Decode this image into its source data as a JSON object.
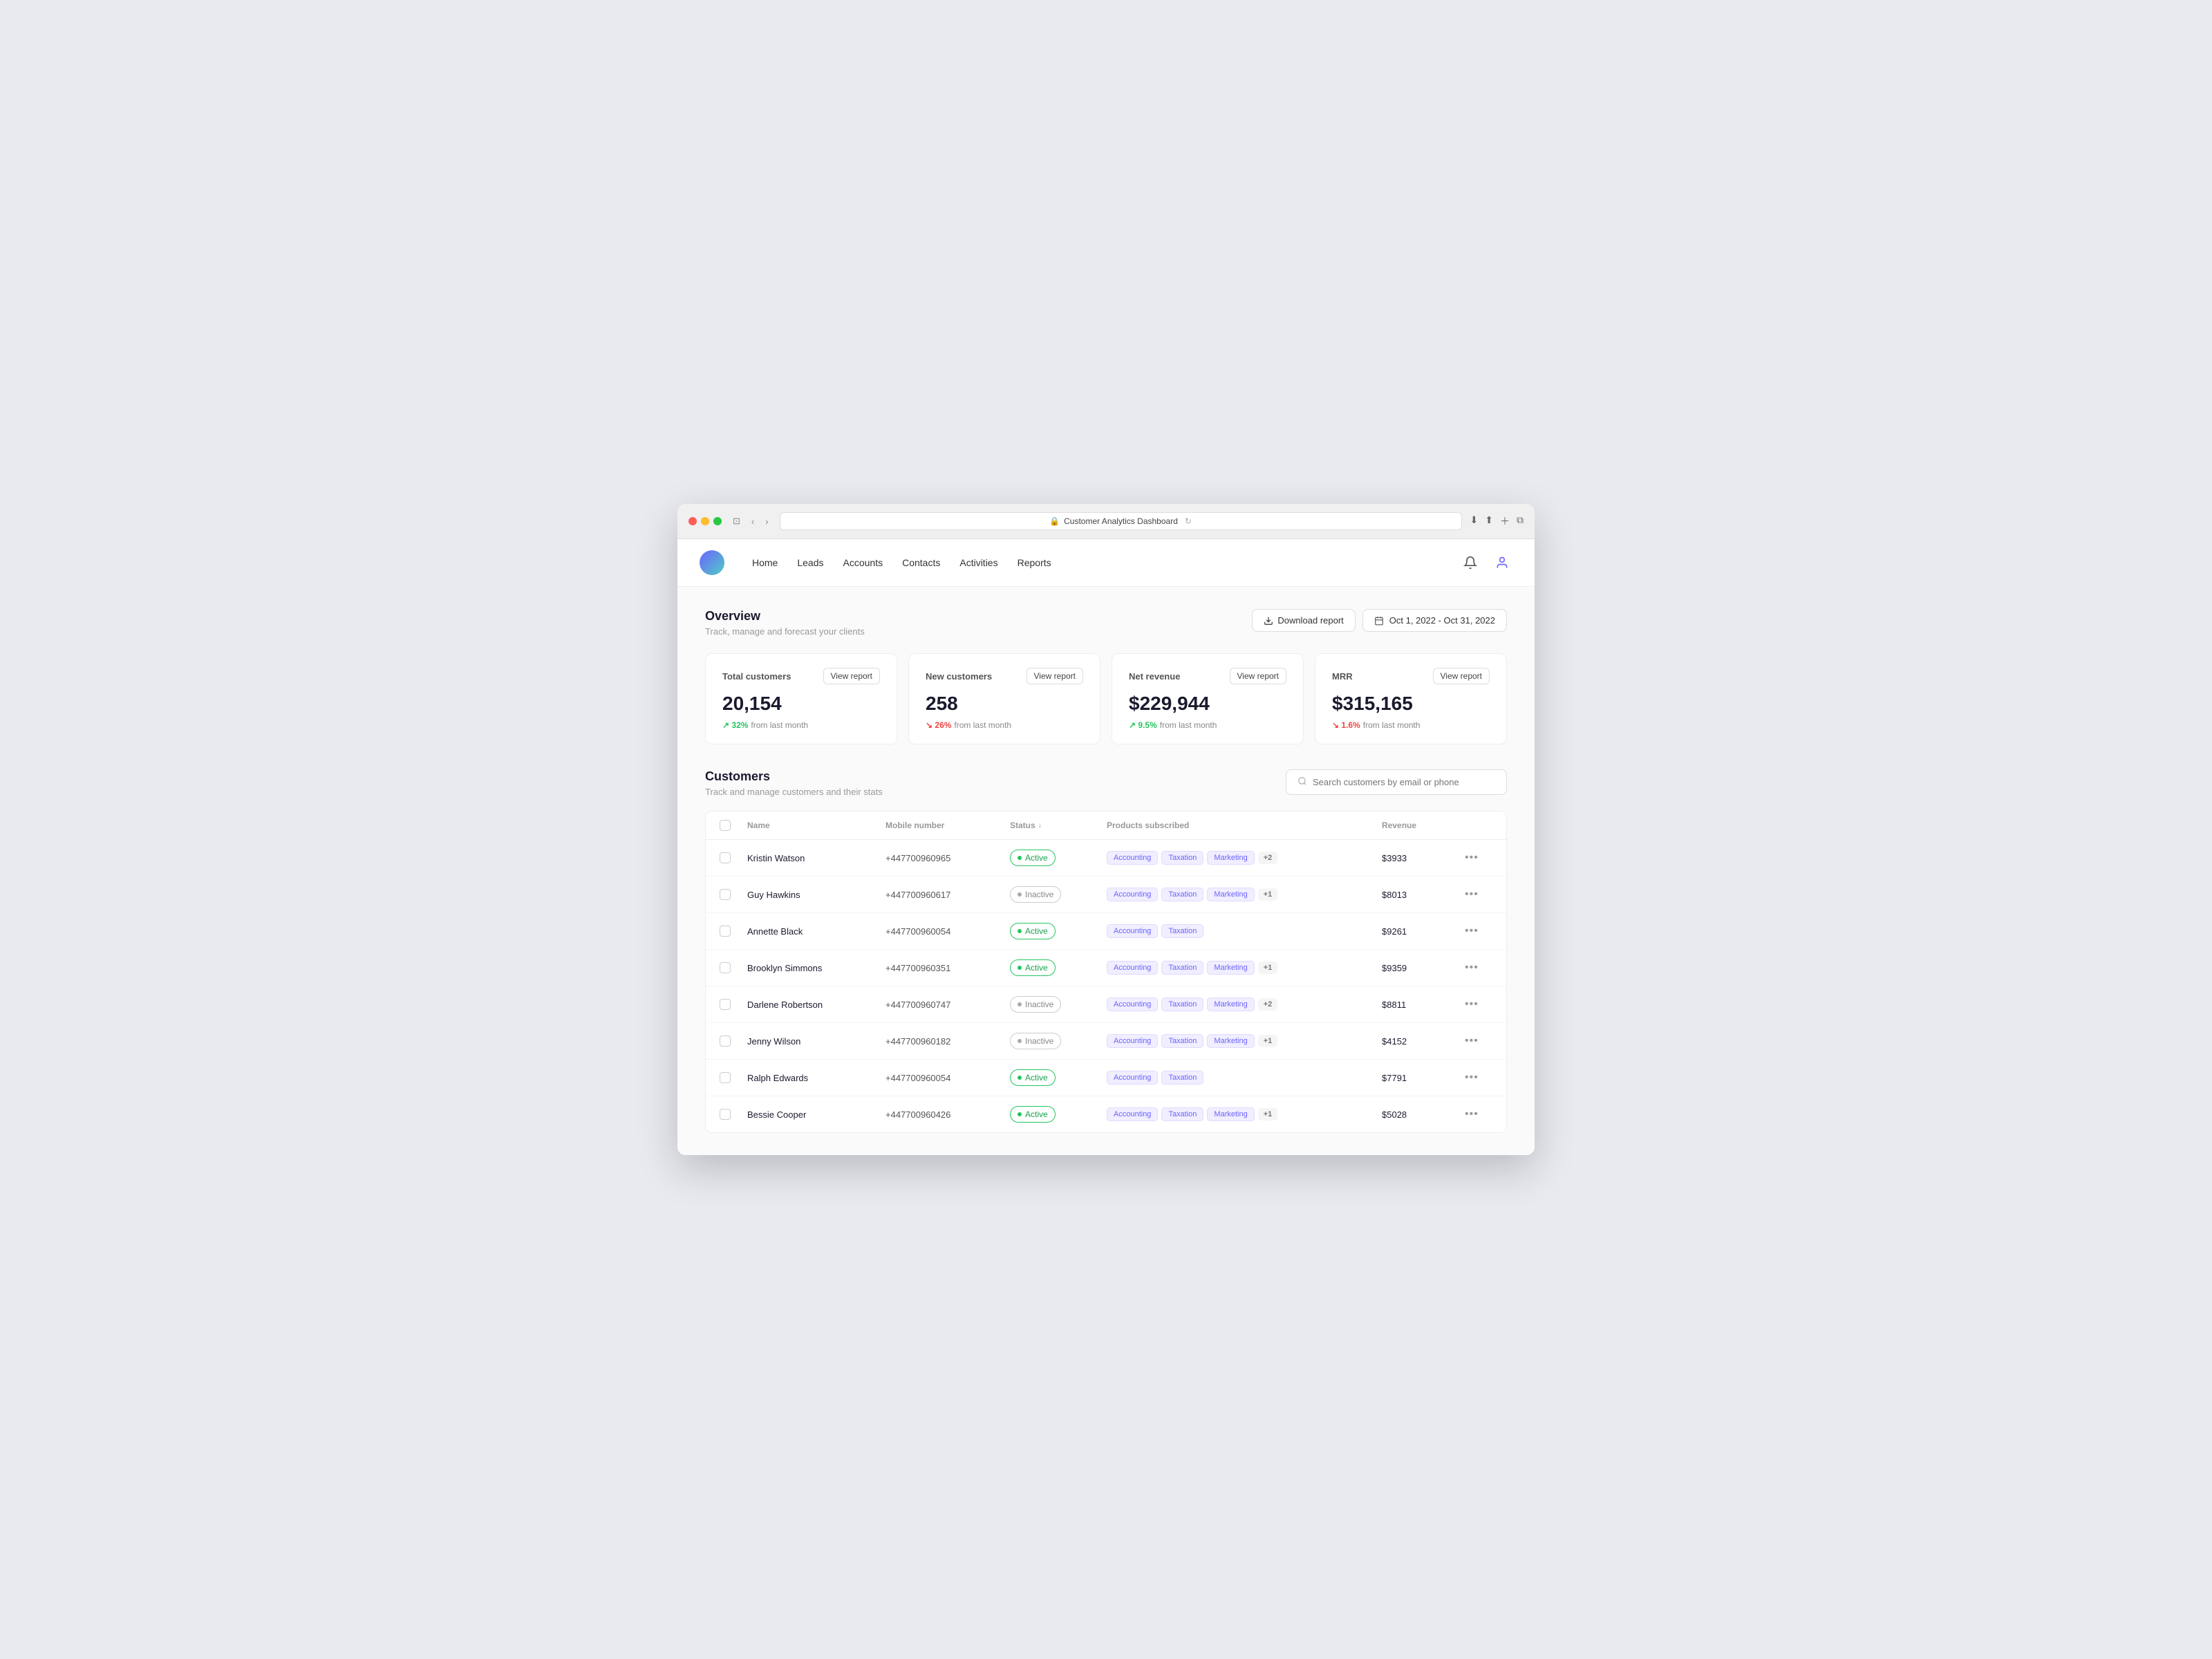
{
  "browser": {
    "url_text": "Customer Analytics Dashboard",
    "url_icon": "🔒"
  },
  "nav": {
    "links": [
      "Home",
      "Leads",
      "Accounts",
      "Contacts",
      "Activities",
      "Reports"
    ]
  },
  "overview": {
    "title": "Overview",
    "subtitle": "Track, manage and forecast your clients",
    "download_label": "Download report",
    "date_range": "Oct 1, 2022 - Oct 31, 2022"
  },
  "metrics": [
    {
      "label": "Total customers",
      "value": "20,154",
      "change": "32%",
      "change_dir": "up",
      "change_text": "from last month",
      "view_label": "View report"
    },
    {
      "label": "New customers",
      "value": "258",
      "change": "26%",
      "change_dir": "down",
      "change_text": "from last month",
      "view_label": "View report"
    },
    {
      "label": "Net revenue",
      "value": "$229,944",
      "change": "9.5%",
      "change_dir": "up",
      "change_text": "from last month",
      "view_label": "View report"
    },
    {
      "label": "MRR",
      "value": "$315,165",
      "change": "1.6%",
      "change_dir": "down",
      "change_text": "from last month",
      "view_label": "View report"
    }
  ],
  "customers": {
    "title": "Customers",
    "subtitle": "Track and manage customers and their stats",
    "search_placeholder": "Search customers by email or phone",
    "table": {
      "columns": [
        "Name",
        "Mobile number",
        "Status",
        "Products subscribed",
        "Revenue"
      ],
      "rows": [
        {
          "name": "Kristin Watson",
          "mobile": "+447700960965",
          "status": "Active",
          "products": [
            "Accounting",
            "Taxation",
            "Marketing"
          ],
          "extra": "+2",
          "revenue": "$3933"
        },
        {
          "name": "Guy Hawkins",
          "mobile": "+447700960617",
          "status": "Inactive",
          "products": [
            "Accounting",
            "Taxation",
            "Marketing"
          ],
          "extra": "+1",
          "revenue": "$8013"
        },
        {
          "name": "Annette Black",
          "mobile": "+447700960054",
          "status": "Active",
          "products": [
            "Accounting",
            "Taxation"
          ],
          "extra": "",
          "revenue": "$9261"
        },
        {
          "name": "Brooklyn Simmons",
          "mobile": "+447700960351",
          "status": "Active",
          "products": [
            "Accounting",
            "Taxation",
            "Marketing"
          ],
          "extra": "+1",
          "revenue": "$9359"
        },
        {
          "name": "Darlene Robertson",
          "mobile": "+447700960747",
          "status": "Inactive",
          "products": [
            "Accounting",
            "Taxation",
            "Marketing"
          ],
          "extra": "+2",
          "revenue": "$8811"
        },
        {
          "name": "Jenny Wilson",
          "mobile": "+447700960182",
          "status": "Inactive",
          "products": [
            "Accounting",
            "Taxation",
            "Marketing"
          ],
          "extra": "+1",
          "revenue": "$4152"
        },
        {
          "name": "Ralph Edwards",
          "mobile": "+447700960054",
          "status": "Active",
          "products": [
            "Accounting",
            "Taxation"
          ],
          "extra": "",
          "revenue": "$7791"
        },
        {
          "name": "Bessie Cooper",
          "mobile": "+447700960426",
          "status": "Active",
          "products": [
            "Accounting",
            "Taxation",
            "Marketing"
          ],
          "extra": "+1",
          "revenue": "$5028"
        }
      ]
    }
  }
}
